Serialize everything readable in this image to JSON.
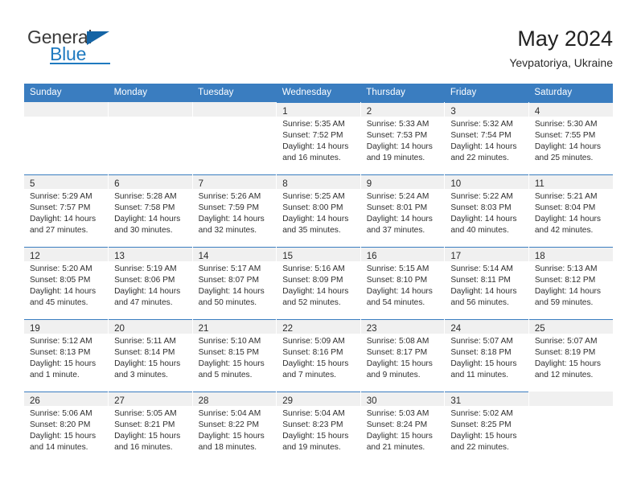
{
  "brand": {
    "name_top": "General",
    "name_bottom": "Blue",
    "triangle_color": "#1464a5",
    "blue": "#1f7ac0"
  },
  "header": {
    "title": "May 2024",
    "subtitle": "Yevpatoriya, Ukraine"
  },
  "theme": {
    "header_bg": "#3a7dc0",
    "daynum_bg": "#f0f0f0",
    "text": "#2f2f2f"
  },
  "weekdays": [
    "Sunday",
    "Monday",
    "Tuesday",
    "Wednesday",
    "Thursday",
    "Friday",
    "Saturday"
  ],
  "weeks": [
    [
      {
        "day": "",
        "lines": []
      },
      {
        "day": "",
        "lines": []
      },
      {
        "day": "",
        "lines": []
      },
      {
        "day": "1",
        "lines": [
          "Sunrise: 5:35 AM",
          "Sunset: 7:52 PM",
          "Daylight: 14 hours",
          "and 16 minutes."
        ]
      },
      {
        "day": "2",
        "lines": [
          "Sunrise: 5:33 AM",
          "Sunset: 7:53 PM",
          "Daylight: 14 hours",
          "and 19 minutes."
        ]
      },
      {
        "day": "3",
        "lines": [
          "Sunrise: 5:32 AM",
          "Sunset: 7:54 PM",
          "Daylight: 14 hours",
          "and 22 minutes."
        ]
      },
      {
        "day": "4",
        "lines": [
          "Sunrise: 5:30 AM",
          "Sunset: 7:55 PM",
          "Daylight: 14 hours",
          "and 25 minutes."
        ]
      }
    ],
    [
      {
        "day": "5",
        "lines": [
          "Sunrise: 5:29 AM",
          "Sunset: 7:57 PM",
          "Daylight: 14 hours",
          "and 27 minutes."
        ]
      },
      {
        "day": "6",
        "lines": [
          "Sunrise: 5:28 AM",
          "Sunset: 7:58 PM",
          "Daylight: 14 hours",
          "and 30 minutes."
        ]
      },
      {
        "day": "7",
        "lines": [
          "Sunrise: 5:26 AM",
          "Sunset: 7:59 PM",
          "Daylight: 14 hours",
          "and 32 minutes."
        ]
      },
      {
        "day": "8",
        "lines": [
          "Sunrise: 5:25 AM",
          "Sunset: 8:00 PM",
          "Daylight: 14 hours",
          "and 35 minutes."
        ]
      },
      {
        "day": "9",
        "lines": [
          "Sunrise: 5:24 AM",
          "Sunset: 8:01 PM",
          "Daylight: 14 hours",
          "and 37 minutes."
        ]
      },
      {
        "day": "10",
        "lines": [
          "Sunrise: 5:22 AM",
          "Sunset: 8:03 PM",
          "Daylight: 14 hours",
          "and 40 minutes."
        ]
      },
      {
        "day": "11",
        "lines": [
          "Sunrise: 5:21 AM",
          "Sunset: 8:04 PM",
          "Daylight: 14 hours",
          "and 42 minutes."
        ]
      }
    ],
    [
      {
        "day": "12",
        "lines": [
          "Sunrise: 5:20 AM",
          "Sunset: 8:05 PM",
          "Daylight: 14 hours",
          "and 45 minutes."
        ]
      },
      {
        "day": "13",
        "lines": [
          "Sunrise: 5:19 AM",
          "Sunset: 8:06 PM",
          "Daylight: 14 hours",
          "and 47 minutes."
        ]
      },
      {
        "day": "14",
        "lines": [
          "Sunrise: 5:17 AM",
          "Sunset: 8:07 PM",
          "Daylight: 14 hours",
          "and 50 minutes."
        ]
      },
      {
        "day": "15",
        "lines": [
          "Sunrise: 5:16 AM",
          "Sunset: 8:09 PM",
          "Daylight: 14 hours",
          "and 52 minutes."
        ]
      },
      {
        "day": "16",
        "lines": [
          "Sunrise: 5:15 AM",
          "Sunset: 8:10 PM",
          "Daylight: 14 hours",
          "and 54 minutes."
        ]
      },
      {
        "day": "17",
        "lines": [
          "Sunrise: 5:14 AM",
          "Sunset: 8:11 PM",
          "Daylight: 14 hours",
          "and 56 minutes."
        ]
      },
      {
        "day": "18",
        "lines": [
          "Sunrise: 5:13 AM",
          "Sunset: 8:12 PM",
          "Daylight: 14 hours",
          "and 59 minutes."
        ]
      }
    ],
    [
      {
        "day": "19",
        "lines": [
          "Sunrise: 5:12 AM",
          "Sunset: 8:13 PM",
          "Daylight: 15 hours",
          "and 1 minute."
        ]
      },
      {
        "day": "20",
        "lines": [
          "Sunrise: 5:11 AM",
          "Sunset: 8:14 PM",
          "Daylight: 15 hours",
          "and 3 minutes."
        ]
      },
      {
        "day": "21",
        "lines": [
          "Sunrise: 5:10 AM",
          "Sunset: 8:15 PM",
          "Daylight: 15 hours",
          "and 5 minutes."
        ]
      },
      {
        "day": "22",
        "lines": [
          "Sunrise: 5:09 AM",
          "Sunset: 8:16 PM",
          "Daylight: 15 hours",
          "and 7 minutes."
        ]
      },
      {
        "day": "23",
        "lines": [
          "Sunrise: 5:08 AM",
          "Sunset: 8:17 PM",
          "Daylight: 15 hours",
          "and 9 minutes."
        ]
      },
      {
        "day": "24",
        "lines": [
          "Sunrise: 5:07 AM",
          "Sunset: 8:18 PM",
          "Daylight: 15 hours",
          "and 11 minutes."
        ]
      },
      {
        "day": "25",
        "lines": [
          "Sunrise: 5:07 AM",
          "Sunset: 8:19 PM",
          "Daylight: 15 hours",
          "and 12 minutes."
        ]
      }
    ],
    [
      {
        "day": "26",
        "lines": [
          "Sunrise: 5:06 AM",
          "Sunset: 8:20 PM",
          "Daylight: 15 hours",
          "and 14 minutes."
        ]
      },
      {
        "day": "27",
        "lines": [
          "Sunrise: 5:05 AM",
          "Sunset: 8:21 PM",
          "Daylight: 15 hours",
          "and 16 minutes."
        ]
      },
      {
        "day": "28",
        "lines": [
          "Sunrise: 5:04 AM",
          "Sunset: 8:22 PM",
          "Daylight: 15 hours",
          "and 18 minutes."
        ]
      },
      {
        "day": "29",
        "lines": [
          "Sunrise: 5:04 AM",
          "Sunset: 8:23 PM",
          "Daylight: 15 hours",
          "and 19 minutes."
        ]
      },
      {
        "day": "30",
        "lines": [
          "Sunrise: 5:03 AM",
          "Sunset: 8:24 PM",
          "Daylight: 15 hours",
          "and 21 minutes."
        ]
      },
      {
        "day": "31",
        "lines": [
          "Sunrise: 5:02 AM",
          "Sunset: 8:25 PM",
          "Daylight: 15 hours",
          "and 22 minutes."
        ]
      },
      {
        "day": "",
        "lines": []
      }
    ]
  ]
}
